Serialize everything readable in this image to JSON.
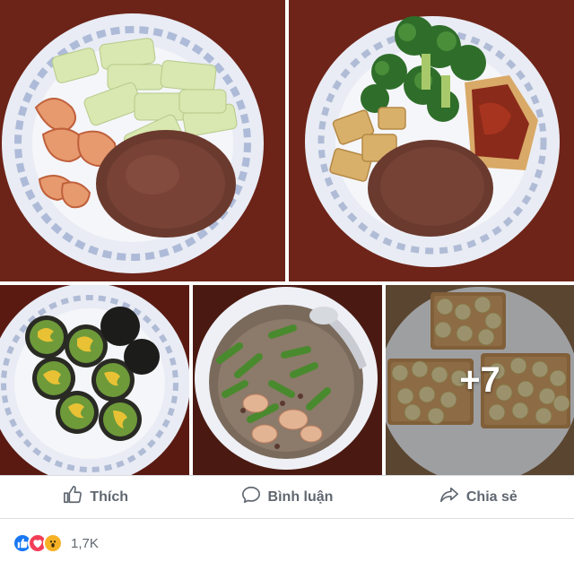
{
  "photos": {
    "more_count": "+7"
  },
  "actions": {
    "like_label": "Thích",
    "comment_label": "Bình luận",
    "share_label": "Chia sẻ"
  },
  "reactions": {
    "icons": [
      "like-icon",
      "love-icon",
      "wow-icon"
    ],
    "count": "1,7K"
  },
  "colors": {
    "action_text": "#606770",
    "like_blue": "#1877f2",
    "love_red": "#f33e58",
    "wow_yellow": "#f7b125"
  }
}
